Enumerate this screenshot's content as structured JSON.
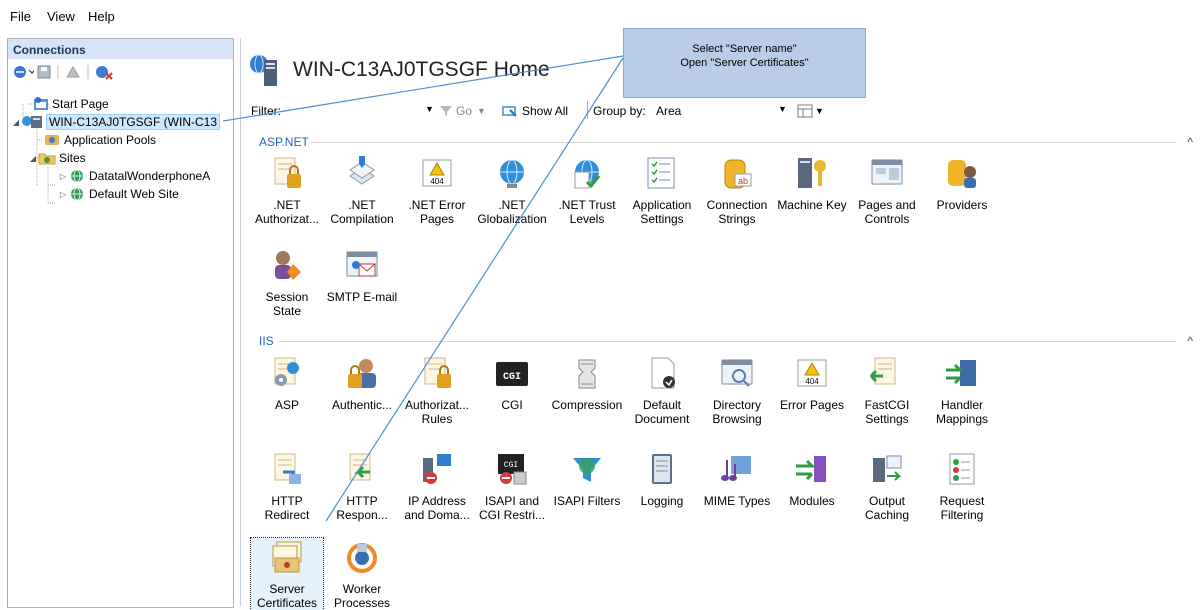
{
  "menu": [
    "File",
    "View",
    "Help"
  ],
  "connections": {
    "header": "Connections",
    "tree": [
      {
        "label": "Start Page",
        "depth": 0
      },
      {
        "label": "WIN-C13AJ0TGSGF (WIN-C13",
        "depth": 0
      },
      {
        "label": "Application Pools",
        "depth": 1
      },
      {
        "label": "Sites",
        "depth": 1
      },
      {
        "label": "DatatalWonderphoneA",
        "depth": 2
      },
      {
        "label": "Default Web Site",
        "depth": 2
      }
    ]
  },
  "main": {
    "title": "WIN-C13AJ0TGSGF Home",
    "filter_label": "Filter:",
    "go_label": "Go",
    "show_all_label": "Show All",
    "group_by_label": "Group by:",
    "group_by_value": "Area"
  },
  "sections": [
    {
      "name": "ASP.NET",
      "items": [
        {
          "line1": ".NET",
          "line2": "Authorizat...",
          "icon": "authorization-icon"
        },
        {
          "line1": ".NET",
          "line2": "Compilation",
          "icon": "compilation-icon"
        },
        {
          "line1": ".NET Error",
          "line2": "Pages",
          "icon": "error-pages-icon"
        },
        {
          "line1": ".NET",
          "line2": "Globalization",
          "icon": "globalization-icon"
        },
        {
          "line1": ".NET Trust",
          "line2": "Levels",
          "icon": "trust-levels-icon"
        },
        {
          "line1": "Application",
          "line2": "Settings",
          "icon": "app-settings-icon"
        },
        {
          "line1": "Connection",
          "line2": "Strings",
          "icon": "connection-strings-icon"
        },
        {
          "line1": "Machine Key",
          "line2": "",
          "icon": "machine-key-icon"
        },
        {
          "line1": "Pages and",
          "line2": "Controls",
          "icon": "pages-controls-icon"
        },
        {
          "line1": "Providers",
          "line2": "",
          "icon": "providers-icon"
        },
        {
          "line1": "Session State",
          "line2": "",
          "icon": "session-state-icon"
        },
        {
          "line1": "SMTP E-mail",
          "line2": "",
          "icon": "smtp-email-icon"
        }
      ]
    },
    {
      "name": "IIS",
      "items": [
        {
          "line1": "ASP",
          "line2": "",
          "icon": "asp-icon"
        },
        {
          "line1": "Authentic...",
          "line2": "",
          "icon": "authentication-icon"
        },
        {
          "line1": "Authorizat...",
          "line2": "Rules",
          "icon": "authorization-rules-icon"
        },
        {
          "line1": "CGI",
          "line2": "",
          "icon": "cgi-icon"
        },
        {
          "line1": "Compression",
          "line2": "",
          "icon": "compression-icon"
        },
        {
          "line1": "Default",
          "line2": "Document",
          "icon": "default-document-icon"
        },
        {
          "line1": "Directory",
          "line2": "Browsing",
          "icon": "directory-browsing-icon"
        },
        {
          "line1": "Error Pages",
          "line2": "",
          "icon": "error-pages-iis-icon"
        },
        {
          "line1": "FastCGI",
          "line2": "Settings",
          "icon": "fastcgi-icon"
        },
        {
          "line1": "Handler",
          "line2": "Mappings",
          "icon": "handler-mappings-icon"
        },
        {
          "line1": "HTTP",
          "line2": "Redirect",
          "icon": "http-redirect-icon"
        },
        {
          "line1": "HTTP",
          "line2": "Respon...",
          "icon": "http-response-icon"
        },
        {
          "line1": "IP Address",
          "line2": "and Doma...",
          "icon": "ip-address-icon"
        },
        {
          "line1": "ISAPI and",
          "line2": "CGI Restri...",
          "icon": "isapi-cgi-icon"
        },
        {
          "line1": "ISAPI Filters",
          "line2": "",
          "icon": "isapi-filters-icon"
        },
        {
          "line1": "Logging",
          "line2": "",
          "icon": "logging-icon"
        },
        {
          "line1": "MIME Types",
          "line2": "",
          "icon": "mime-types-icon"
        },
        {
          "line1": "Modules",
          "line2": "",
          "icon": "modules-icon"
        },
        {
          "line1": "Output",
          "line2": "Caching",
          "icon": "output-caching-icon"
        },
        {
          "line1": "Request",
          "line2": "Filtering",
          "icon": "request-filtering-icon"
        },
        {
          "line1": "Server",
          "line2": "Certificates",
          "icon": "server-certificates-icon"
        },
        {
          "line1": "Worker",
          "line2": "Processes",
          "icon": "worker-processes-icon"
        }
      ]
    }
  ],
  "callout": {
    "line1": "Select \"Server name\"",
    "line2": "Open \"Server Certificates\""
  },
  "colors": {
    "accent": "#1e63b8",
    "callout_bg": "#b9cde6",
    "callout_line": "#4a90d9"
  }
}
